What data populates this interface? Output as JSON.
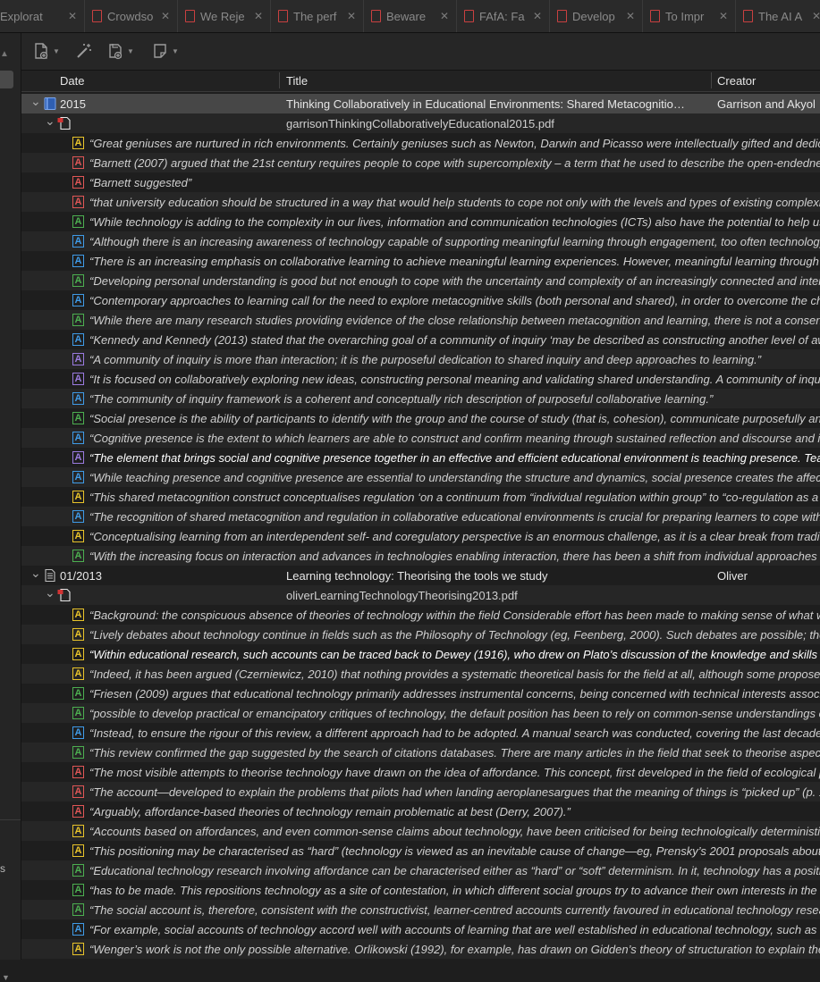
{
  "tabs": [
    {
      "label": "Explorat"
    },
    {
      "label": "Crowdso"
    },
    {
      "label": "We Reje"
    },
    {
      "label": "The perf"
    },
    {
      "label": "Beware "
    },
    {
      "label": "FAfA: Fa"
    },
    {
      "label": "Develop"
    },
    {
      "label": "To Impr"
    },
    {
      "label": "The AI A"
    }
  ],
  "toolbar": {
    "buttons": [
      {
        "icon": "new-item-icon"
      },
      {
        "icon": "magic-wand-icon"
      },
      {
        "icon": "add-attachment-icon"
      },
      {
        "icon": "new-note-icon"
      }
    ]
  },
  "sidebar": {
    "partial_label": "s"
  },
  "columns": {
    "date": "Date",
    "title": "Title",
    "creator": "Creator"
  },
  "colors": {
    "yellow": "#e8c32a",
    "red": "#e05656",
    "green": "#4caf50",
    "blue": "#3f9be8",
    "purple": "#9a7be0"
  },
  "items": [
    {
      "date": "2015",
      "title": "Thinking Collaboratively in Educational Environments: Shared Metacognitio…",
      "creator": "Garrison and Akyol",
      "attachment": "garrisonThinkingCollaborativelyEducational2015.pdf",
      "annotations": [
        {
          "color": "yellow",
          "text": "“Great geniuses are nurtured in rich environments. Certainly geniuses such as Newton, Darwin and Picasso were intellectually gifted and dedicat"
        },
        {
          "color": "red",
          "text": "“Barnett (2007) argued that the 21st century requires people to cope with supercomplexity – a term that he used to describe the open-endednes"
        },
        {
          "color": "red",
          "text": "“Barnett suggested”"
        },
        {
          "color": "red",
          "text": "“that university education should be structured in a way that would help students to cope not only with the levels and types of existing complexit"
        },
        {
          "color": "green",
          "text": "“While technology is adding to the complexity in our lives, information and communication technologies (ICTs) also have the potential to help us t"
        },
        {
          "color": "blue",
          "text": "“Although there is an increasing awareness of technology capable of supporting meaningful learning through engagement, too often technology"
        },
        {
          "color": "blue",
          "text": "“There is an increasing emphasis on collaborative learning to achieve meaningful learning experiences. However, meaningful learning through co"
        },
        {
          "color": "green",
          "text": "“Developing personal understanding is good but not enough to cope with the uncertainty and complexity of an increasingly connected and interc"
        },
        {
          "color": "blue",
          "text": "“Contemporary approaches to learning call for the need to explore metacognitive skills (both personal and shared), in order to overcome the cha"
        },
        {
          "color": "green",
          "text": "“While there are many research studies providing evidence of the close relationship between metacognition and learning, there is not a consensu"
        },
        {
          "color": "blue",
          "text": "“Kennedy and Kennedy (2013) stated that the overarching goal of a community of inquiry ‘may be described as constructing another level of awa"
        },
        {
          "color": "purple",
          "text": "“A community of inquiry is more than interaction; it is the purposeful dedication to shared inquiry and deep approaches to learning.”"
        },
        {
          "color": "purple",
          "text": "“It is focused on collaboratively exploring new ideas, constructing personal meaning and validating shared understanding. A community of inquiry"
        },
        {
          "color": "blue",
          "text": "“The community of inquiry framework is a coherent and conceptually rich description of purposeful collaborative learning.”"
        },
        {
          "color": "green",
          "text": "“Social presence is the ability of participants to identify with the group and the course of study (that is, cohesion), communicate purposefully and"
        },
        {
          "color": "blue",
          "text": "“Cognitive presence is the extent to which learners are able to construct and confirm meaning through sustained reflection and discourse and is"
        },
        {
          "color": "purple",
          "text": "“The element that brings social and cognitive presence together in an effective and efficient educational environment is teaching presence. Teac",
          "bright": true
        },
        {
          "color": "blue",
          "text": "“While teaching presence and cognitive presence are essential to understanding the structure and dynamics, social presence creates the affectiv"
        },
        {
          "color": "yellow",
          "text": "“This shared metacognition construct conceptualises regulation ‘on a continuum from “individual regulation within group” to “co-regulation as a"
        },
        {
          "color": "blue",
          "text": "“The recognition of shared metacognition and regulation in collaborative educational environments is crucial for preparing learners to cope with t"
        },
        {
          "color": "yellow",
          "text": "“Conceptualising learning from an interdependent self- and coregulatory perspective is an enormous challenge, as it is a clear break from traditic"
        },
        {
          "color": "green",
          "text": "“With the increasing focus on interaction and advances in technologies enabling interaction, there has been a shift from individual approaches to"
        }
      ]
    },
    {
      "date": "01/2013",
      "title": "Learning technology: Theorising the tools we study",
      "creator": "Oliver",
      "attachment": "oliverLearningTechnologyTheorising2013.pdf",
      "annotations": [
        {
          "color": "yellow",
          "text": "“Background: the conspicuous absence of theories of technology within the field Considerable effort has been made to making sense of what we"
        },
        {
          "color": "yellow",
          "text": "“Lively debates about technology continue in fields such as the Philosophy of Technology (eg, Feenberg, 2000). Such debates are possible; they"
        },
        {
          "color": "yellow",
          "text": "“Within educational research, such accounts can be traced back to Dewey (1916), who drew on Plato’s discussion of the knowledge and skills of",
          "bright": true
        },
        {
          "color": "yellow",
          "text": "“Indeed, it has been argued (Czerniewicz, 2010) that nothing provides a systematic theoretical basis for the field at all, although some propose th"
        },
        {
          "color": "green",
          "text": "“Friesen (2009) argues that educational technology primarily addresses instrumental concerns, being concerned with technical interests associa"
        },
        {
          "color": "green",
          "text": "“possible to develop practical or emancipatory critiques of technology, the default position has been to rely on common-sense understandings o"
        },
        {
          "color": "blue",
          "text": "“Instead, to ensure the rigour of this review, a different approach had to be adopted. A manual search was conducted, covering the last decade’s"
        },
        {
          "color": "green",
          "text": "“This review confirmed the gap suggested by the search of citations databases. There are many articles in the field that seek to theorise aspects"
        },
        {
          "color": "red",
          "text": "“The most visible attempts to theorise technology have drawn on the idea of affordance. This concept, first developed in the field of ecological p"
        },
        {
          "color": "red",
          "text": "“The account—developed to explain the problems that pilots had when landing aeroplanesargues that the meaning of things is “picked up” (p. 14"
        },
        {
          "color": "red",
          "text": "“Arguably, affordance-based theories of technology remain problematic at best (Derry, 2007).”"
        },
        {
          "color": "yellow",
          "text": "“Accounts based on affordances, and even common-sense claims about technology, have been criticised for being technologically deterministic"
        },
        {
          "color": "yellow",
          "text": "“This positioning may be characterised as “hard” (technology is viewed as an inevitable cause of change—eg, Prensky’s 2001 proposals about ga"
        },
        {
          "color": "green",
          "text": "“Educational technology research involving affordance can be characterised either as “hard” or “soft” determinism. In it, technology has a positi"
        },
        {
          "color": "green",
          "text": "“has to be made. This repositions technology as a site of contestation, in which different social groups try to advance their own interests in the w"
        },
        {
          "color": "green",
          "text": "“The social account is, therefore, consistent with the constructivist, learner-centred accounts currently favoured in educational technology resea"
        },
        {
          "color": "blue",
          "text": "“For example, social accounts of technology accord well with accounts of learning that are well established in educational technology, such as W"
        },
        {
          "color": "yellow",
          "text": "“Wenger’s work is not the only possible alternative. Orlikowski (1992), for example, has drawn on Gidden’s theory of structuration to explain the"
        }
      ]
    }
  ]
}
